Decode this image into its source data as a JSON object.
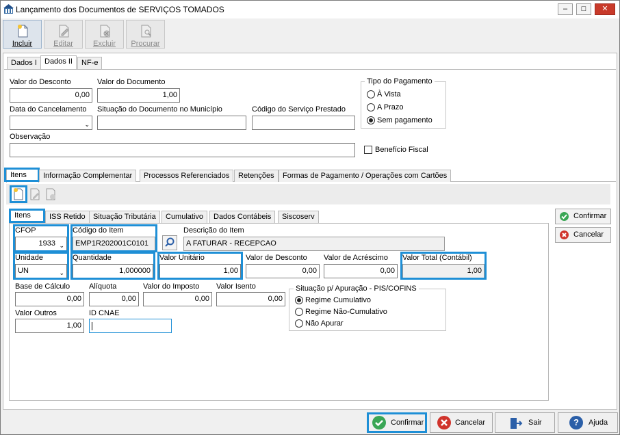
{
  "window": {
    "title": "Lançamento dos Documentos de SERVIÇOS TOMADOS",
    "min_label": "–",
    "max_label": "□",
    "close_label": "✕"
  },
  "toolbar": {
    "incluir": "Incluir",
    "editar": "Editar",
    "excluir": "Excluir",
    "procurar": "Procurar"
  },
  "top_tabs": [
    "Dados I",
    "Dados II",
    "NF-e"
  ],
  "dados2": {
    "valor_desconto_label": "Valor do Desconto",
    "valor_desconto": "0,00",
    "valor_documento_label": "Valor do Documento",
    "valor_documento": "1,00",
    "data_cancelamento_label": "Data do Cancelamento",
    "data_cancelamento": "",
    "situacao_label": "Situação do Documento no Município",
    "situacao": "",
    "codigo_servico_label": "Código do Serviço Prestado",
    "codigo_servico": "",
    "observacao_label": "Observação",
    "observacao": "",
    "beneficio_fiscal_label": "Benefício Fiscal",
    "tipo_pagamento": {
      "title": "Tipo do Pagamento",
      "options": [
        "À Vista",
        "A Prazo",
        "Sem pagamento"
      ],
      "selected": "Sem pagamento"
    }
  },
  "mid_tabs": [
    "Itens",
    "Informação Complementar",
    "Processos Referenciados",
    "Retenções",
    "Formas de Pagamento / Operações com Cartões"
  ],
  "item_tabs": [
    "Itens",
    "ISS Retido",
    "Situação Tributária",
    "Cumulativo",
    "Dados Contábeis",
    "Siscoserv"
  ],
  "item": {
    "cfop_label": "CFOP",
    "cfop": "1933",
    "codigo_item_label": "Código do Item",
    "codigo_item": "EMP1R202001C0101",
    "descricao_label": "Descrição do Item",
    "descricao": "A FATURAR  -  RECEPCAO",
    "unidade_label": "Unidade",
    "unidade": "UN",
    "quantidade_label": "Quantidade",
    "quantidade": "1,000000",
    "valor_unitario_label": "Valor Unitário",
    "valor_unitario": "1,00",
    "valor_desconto_label": "Valor de Desconto",
    "valor_desconto": "0,00",
    "valor_acrescimo_label": "Valor de Acréscimo",
    "valor_acrescimo": "0,00",
    "valor_total_label": "Valor Total (Contábil)",
    "valor_total": "1,00",
    "base_calculo_label": "Base de Cálculo",
    "base_calculo": "0,00",
    "aliquota_label": "Alíquota",
    "aliquota": "0,00",
    "valor_imposto_label": "Valor do Imposto",
    "valor_imposto": "0,00",
    "valor_isento_label": "Valor Isento",
    "valor_isento": "0,00",
    "valor_outros_label": "Valor Outros",
    "valor_outros": "1,00",
    "id_cnae_label": "ID CNAE",
    "id_cnae": "",
    "apuracao": {
      "title": "Situação p/ Apuração - PIS/COFINS",
      "options": [
        "Regime Cumulativo",
        "Regime Não-Cumulativo",
        "Não Apurar"
      ],
      "selected": "Regime Cumulativo"
    }
  },
  "side_buttons": {
    "confirmar": "Confirmar",
    "cancelar": "Cancelar"
  },
  "bottom_buttons": {
    "confirmar": "Confirmar",
    "cancelar": "Cancelar",
    "sair": "Sair",
    "ajuda": "Ajuda"
  },
  "colors": {
    "highlight": "#1e8fd6",
    "confirm_green": "#3aa655",
    "cancel_red": "#d0342c",
    "help_blue": "#2b5fa8"
  }
}
